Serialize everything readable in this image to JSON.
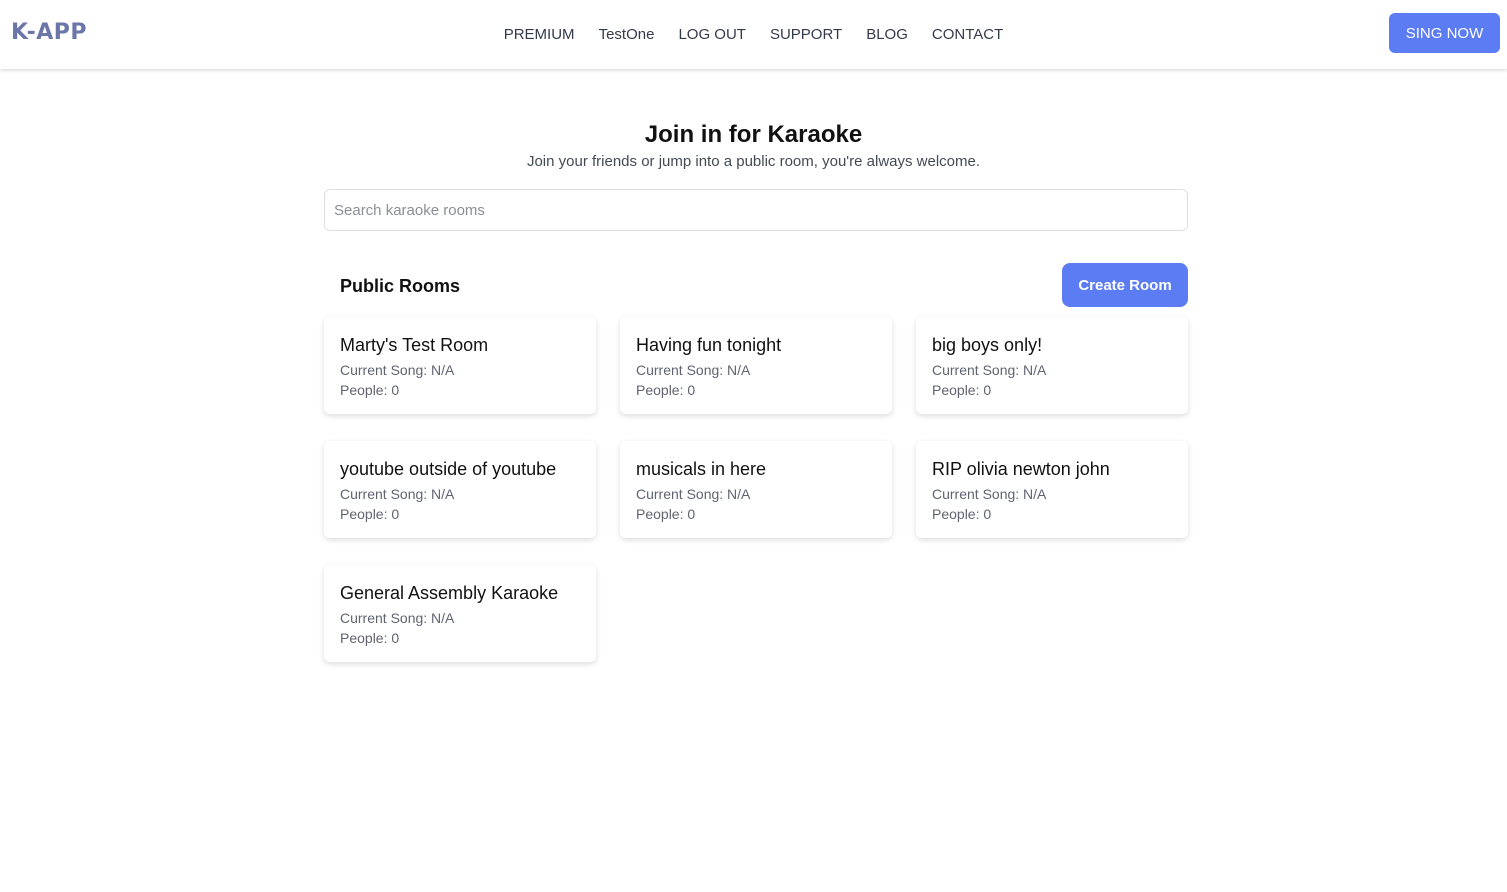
{
  "brand": {
    "logo": "K-APP"
  },
  "nav": {
    "links": [
      "PREMIUM",
      "TestOne",
      "LOG OUT",
      "SUPPORT",
      "BLOG",
      "CONTACT"
    ],
    "cta_label": "SING NOW"
  },
  "hero": {
    "title": "Join in for Karaoke",
    "subtitle": "Join your friends or jump into a public room, you're always welcome."
  },
  "search": {
    "placeholder": "Search karaoke rooms",
    "value": ""
  },
  "rooms_section": {
    "title": "Public Rooms",
    "create_label": "Create Room",
    "rooms": [
      {
        "name": "Marty's Test Room",
        "current_song": "Current Song: N/A",
        "people": "People: 0"
      },
      {
        "name": "Having fun tonight",
        "current_song": "Current Song: N/A",
        "people": "People: 0"
      },
      {
        "name": "big boys only!",
        "current_song": "Current Song: N/A",
        "people": "People: 0"
      },
      {
        "name": "youtube outside of youtube",
        "current_song": "Current Song: N/A",
        "people": "People: 0"
      },
      {
        "name": "musicals in here",
        "current_song": "Current Song: N/A",
        "people": "People: 0"
      },
      {
        "name": "RIP olivia newton john",
        "current_song": "Current Song: N/A",
        "people": "People: 0"
      },
      {
        "name": "General Assembly Karaoke",
        "current_song": "Current Song: N/A",
        "people": "People: 0"
      }
    ]
  },
  "colors": {
    "accent": "#5b7cf2",
    "logo": "#6b76a8"
  }
}
